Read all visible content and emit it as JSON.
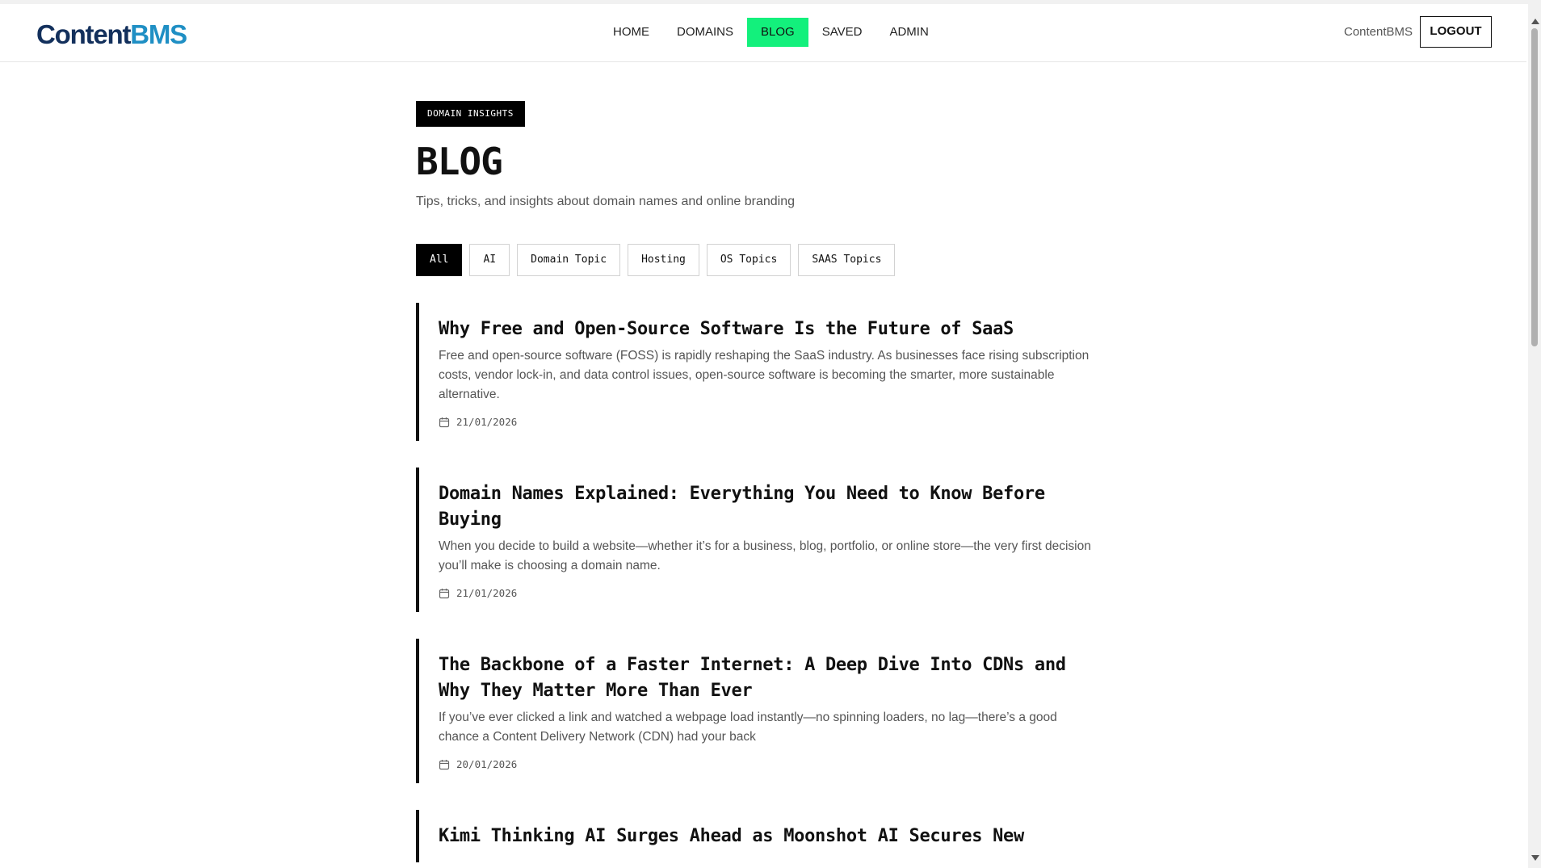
{
  "header": {
    "logo_part1": "Content",
    "logo_part2": "BMS",
    "nav": [
      {
        "label": "HOME"
      },
      {
        "label": "DOMAINS"
      },
      {
        "label": "BLOG",
        "active": true
      },
      {
        "label": "SAVED"
      },
      {
        "label": "ADMIN"
      }
    ],
    "user_label": "ContentBMS",
    "logout_label": "LOGOUT"
  },
  "colors": {
    "nav_active": "#13f07c",
    "logo_dark": "#13305c",
    "logo_light": "#1f8fc4"
  },
  "main": {
    "badge": "DOMAIN INSIGHTS",
    "title": "BLOG",
    "subtitle": "Tips, tricks, and insights about domain names and online branding",
    "filters": [
      {
        "label": "All",
        "active": true
      },
      {
        "label": "AI"
      },
      {
        "label": "Domain Topic"
      },
      {
        "label": "Hosting"
      },
      {
        "label": "OS Topics"
      },
      {
        "label": "SAAS Topics"
      }
    ],
    "posts": [
      {
        "title": "Why Free and Open-Source Software Is the Future of SaaS",
        "excerpt": "Free and open-source software (FOSS) is rapidly reshaping the SaaS industry. As businesses face rising subscription costs, vendor lock-in, and data control issues, open-source software is becoming the smarter, more sustainable alternative.",
        "date": "21/01/2026"
      },
      {
        "title": "Domain Names Explained: Everything You Need to Know Before Buying",
        "excerpt": "When you decide to build a website—whether it’s for a business, blog, portfolio, or online store—the very first decision you’ll make is choosing a domain name.",
        "date": "21/01/2026"
      },
      {
        "title": "The Backbone of a Faster Internet: A Deep Dive Into CDNs and Why They Matter More Than Ever",
        "excerpt": "If you’ve ever clicked a link and watched a webpage load instantly—no spinning loaders, no lag—there’s a good chance a Content Delivery Network (CDN) had your back",
        "date": "20/01/2026"
      },
      {
        "title": "Kimi Thinking AI Surges Ahead as Moonshot AI Secures New",
        "excerpt": "",
        "date": ""
      }
    ]
  }
}
